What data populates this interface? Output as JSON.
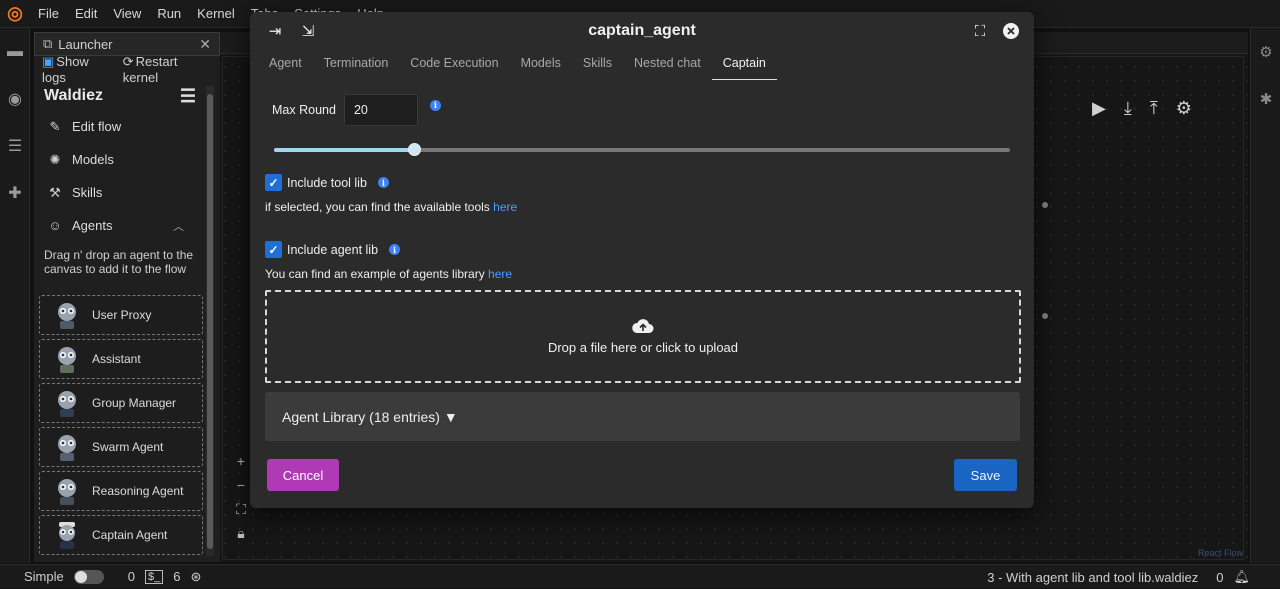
{
  "menubar": {
    "items": [
      "File",
      "Edit",
      "View",
      "Run",
      "Kernel",
      "Tabs",
      "Settings",
      "Help"
    ]
  },
  "launcher": {
    "tab_label": "Launcher",
    "show_logs": "Show logs",
    "restart_kernel": "Restart kernel"
  },
  "sidebar": {
    "title": "Waldiez",
    "items": [
      {
        "label": "Edit flow",
        "icon": "edit-icon"
      },
      {
        "label": "Models",
        "icon": "models-icon"
      },
      {
        "label": "Skills",
        "icon": "skills-icon"
      },
      {
        "label": "Agents",
        "icon": "robot-icon"
      }
    ],
    "hint": "Drag n' drop an agent to the canvas to add it to the flow",
    "agents": [
      "User Proxy",
      "Assistant",
      "Group Manager",
      "Swarm Agent",
      "Reasoning Agent",
      "Captain Agent"
    ]
  },
  "modal": {
    "title": "captain_agent",
    "tabs": [
      "Agent",
      "Termination",
      "Code Execution",
      "Models",
      "Skills",
      "Nested chat",
      "Captain"
    ],
    "active_tab": "Captain",
    "max_round_label": "Max Round",
    "max_round_value": "20",
    "max_round_fraction": 0.19,
    "include_tool_lib": {
      "label": "Include tool lib",
      "checked": true,
      "hint": "if selected, you can find the available tools",
      "link": "here"
    },
    "include_agent_lib": {
      "label": "Include agent lib",
      "checked": true,
      "hint": "You can find an example of agents library",
      "link": "here"
    },
    "dropzone_text": "Drop a file here or click to upload",
    "agent_library_label": "Agent Library (18 entries) ▼",
    "cancel_label": "Cancel",
    "save_label": "Save"
  },
  "statusbar": {
    "mode_label": "Simple",
    "count_a": "0",
    "count_b": "6",
    "file_name": "3 - With agent lib and tool lib.waldiez",
    "notifications": "0"
  },
  "react_flow_attribution": "React Flow",
  "colors": {
    "cancel": "#b03ab5",
    "save": "#1a64c4",
    "checkbox": "#1f6fd6",
    "link": "#4a9eff"
  }
}
